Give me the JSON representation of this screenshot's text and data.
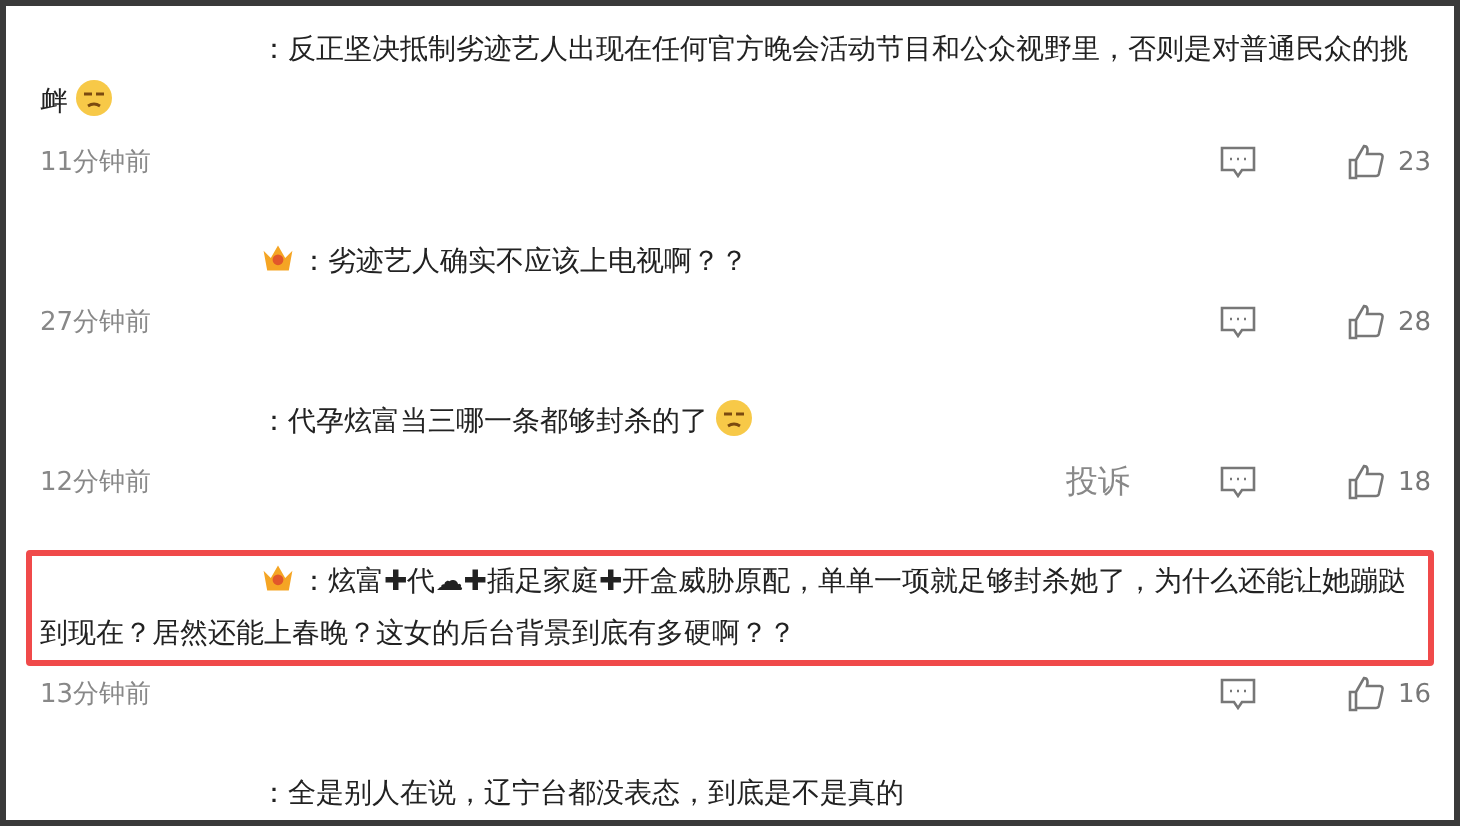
{
  "comments": [
    {
      "badge": false,
      "emoji": true,
      "text": "：反正坚决抵制劣迹艺人出现在任何官方晚会活动节目和公众视野里，否则是对普通民众的挑衅",
      "highlighted": false,
      "time": "11分钟前",
      "likes": "23"
    },
    {
      "badge": true,
      "text": "：劣迹艺人确实不应该上电视啊？？",
      "highlighted": false,
      "time": "27分钟前",
      "likes": "28"
    },
    {
      "badge": false,
      "emoji": true,
      "text": "：代孕炫富当三哪一条都够封杀的了",
      "highlighted": false,
      "time": "12分钟前",
      "report": "投诉",
      "likes": "18"
    },
    {
      "badge": true,
      "text": "：炫富✚代☁✚插足家庭✚开盒威胁原配，单单一项就足够封杀她了，为什么还能让她蹦跶到现在？居然还能上春晚？这女的后台背景到底有多硬啊？？",
      "highlighted": true,
      "time": "13分钟前",
      "likes": "16"
    },
    {
      "badge": false,
      "text": "：全是别人在说，辽宁台都没表态，到底是不是真的",
      "highlighted": false
    }
  ]
}
